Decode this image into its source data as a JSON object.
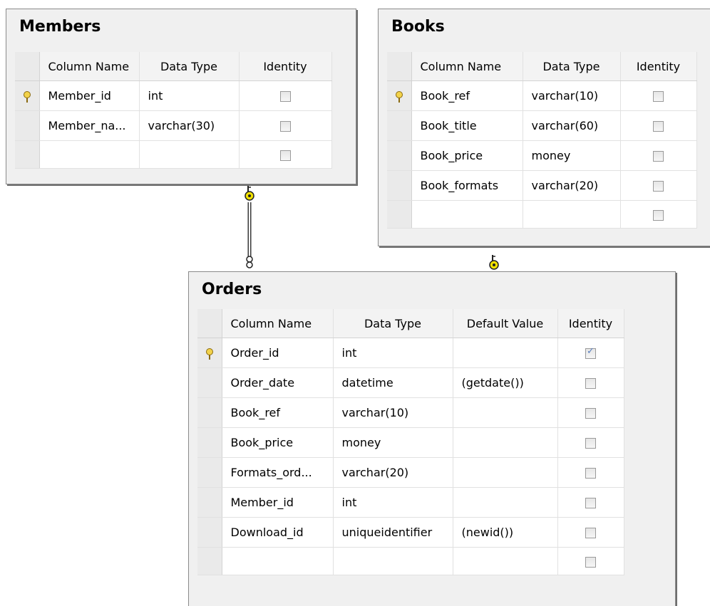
{
  "members": {
    "title": "Members",
    "headers": [
      "Column Name",
      "Data Type",
      "Identity"
    ],
    "rows": [
      {
        "name": "Member_id",
        "type": "int",
        "identity": false,
        "key": true
      },
      {
        "name": "Member_na...",
        "type": "varchar(30)",
        "identity": false,
        "key": false
      }
    ]
  },
  "books": {
    "title": "Books",
    "headers": [
      "Column Name",
      "Data Type",
      "Identity"
    ],
    "rows": [
      {
        "name": "Book_ref",
        "type": "varchar(10)",
        "identity": false,
        "key": true
      },
      {
        "name": "Book_title",
        "type": "varchar(60)",
        "identity": false,
        "key": false
      },
      {
        "name": "Book_price",
        "type": "money",
        "identity": false,
        "key": false
      },
      {
        "name": "Book_formats",
        "type": "varchar(20)",
        "identity": false,
        "key": false
      }
    ]
  },
  "orders": {
    "title": "Orders",
    "headers": [
      "Column Name",
      "Data Type",
      "Default Value",
      "Identity"
    ],
    "rows": [
      {
        "name": "Order_id",
        "type": "int",
        "default": "",
        "identity": true,
        "key": true
      },
      {
        "name": "Order_date",
        "type": "datetime",
        "default": "(getdate())",
        "identity": false,
        "key": false
      },
      {
        "name": "Book_ref",
        "type": "varchar(10)",
        "default": "",
        "identity": false,
        "key": false
      },
      {
        "name": "Book_price",
        "type": "money",
        "default": "",
        "identity": false,
        "key": false
      },
      {
        "name": "Formats_ord...",
        "type": "varchar(20)",
        "default": "",
        "identity": false,
        "key": false
      },
      {
        "name": "Member_id",
        "type": "int",
        "default": "",
        "identity": false,
        "key": false
      },
      {
        "name": "Download_id",
        "type": "uniqueidentifier",
        "default": "(newid())",
        "identity": false,
        "key": false
      }
    ]
  },
  "icons": {
    "primary_key": "primary-key-icon",
    "relationship_one": "key-end-icon",
    "relationship_many": "infinity-end-icon"
  },
  "colors": {
    "key_yellow": "#f2d24a",
    "panel_bg": "#f0f0f0",
    "check_blue": "#5a7fbf"
  }
}
